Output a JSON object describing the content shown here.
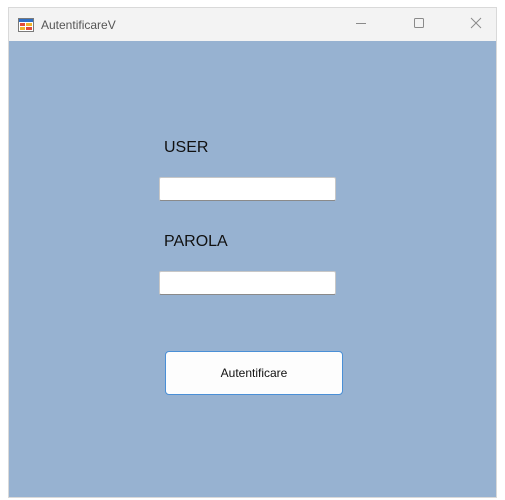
{
  "window": {
    "title": "AutentificareV",
    "app_icon": "winforms-app-icon",
    "controls": {
      "minimize_icon": "minimize-icon",
      "maximize_icon": "maximize-icon",
      "close_icon": "close-icon"
    },
    "background_color": "#97b2d1"
  },
  "form": {
    "user_label": "USER",
    "user_value": "",
    "password_label": "PAROLA",
    "password_value": "",
    "submit_label": "Autentificare",
    "submit_border_color": "#4a8fd6"
  }
}
